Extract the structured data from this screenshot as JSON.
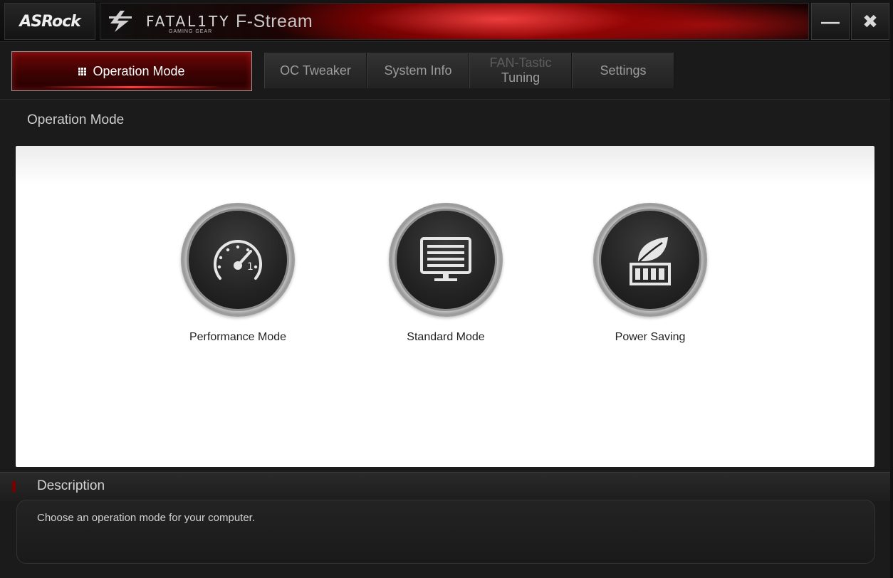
{
  "titlebar": {
    "brand": "ASRock",
    "fatal_text": "FATAL1TY",
    "fatal_sub": "GAMING GEAR",
    "app_title": "F-Stream",
    "minimize_glyph": "—",
    "close_glyph": "✖"
  },
  "tabs": {
    "active": "Operation Mode",
    "items": [
      {
        "label": "OC Tweaker"
      },
      {
        "label": "System Info"
      },
      {
        "label_top": "FAN-Tastic",
        "label_bottom": "Tuning"
      },
      {
        "label": "Settings"
      }
    ]
  },
  "section": {
    "title": "Operation Mode"
  },
  "modes": [
    {
      "label": "Performance Mode",
      "icon": "speedometer-icon"
    },
    {
      "label": "Standard Mode",
      "icon": "monitor-icon"
    },
    {
      "label": "Power Saving",
      "icon": "leaf-battery-icon"
    }
  ],
  "description": {
    "title": "Description",
    "text": "Choose an operation mode for your computer."
  },
  "colors": {
    "accent_red": "#7a0000",
    "panel_bg": "#ffffff",
    "window_bg": "#1b1b1b"
  }
}
